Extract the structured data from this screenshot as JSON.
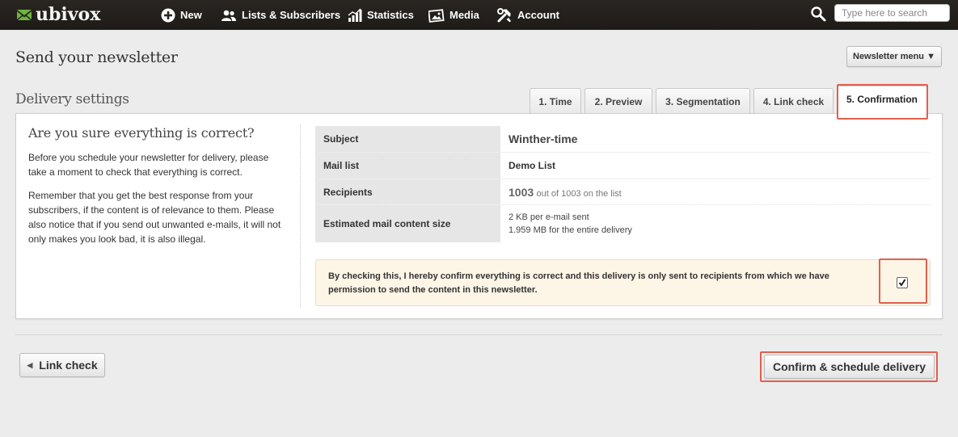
{
  "brand": {
    "name": "ubivox"
  },
  "nav": {
    "items": [
      {
        "label": "New",
        "icon": "plus-circle-icon"
      },
      {
        "label": "Lists & Subscribers",
        "icon": "users-icon"
      },
      {
        "label": "Statistics",
        "icon": "bar-chart-icon"
      },
      {
        "label": "Media",
        "icon": "image-icon"
      },
      {
        "label": "Account",
        "icon": "tools-icon"
      }
    ],
    "search_placeholder": "Type here to search"
  },
  "page": {
    "title": "Send your newsletter",
    "menu_button": "Newsletter menu ▼"
  },
  "section": {
    "title": "Delivery settings",
    "tabs": [
      "1. Time",
      "2. Preview",
      "3. Segmentation",
      "4. Link check",
      "5. Confirmation"
    ],
    "active_tab": "5. Confirmation"
  },
  "left": {
    "heading": "Are you sure everything is correct?",
    "para1": "Before you schedule your newsletter for delivery, please take a moment to check that everything is correct.",
    "para2": "Remember that you get the best response from your subscribers, if the content is of relevance to them. Please also notice that if you send out unwanted e-mails, it will not only makes you look bad, it is also illegal."
  },
  "details": {
    "subject_label": "Subject",
    "subject_value": "Winther-time",
    "maillist_label": "Mail list",
    "maillist_value": "Demo List",
    "recipients_label": "Recipients",
    "recipients_count": "1003",
    "recipients_note": "out of 1003 on the list",
    "size_label": "Estimated mail content size",
    "size_per_mail": "2 KB per e-mail sent",
    "size_total": "1.959 MB for the entire delivery"
  },
  "confirm": {
    "text": "By checking this, I hereby confirm everything is correct and this delivery is only sent to recipients from which we have permission to send the content in this newsletter.",
    "checked": true
  },
  "footer": {
    "back_label": "Link check",
    "confirm_label": "Confirm & schedule delivery"
  },
  "colors": {
    "highlight": "#e0604e",
    "confirm_bg": "#fdf5e6",
    "topbar": "#2a2622"
  }
}
